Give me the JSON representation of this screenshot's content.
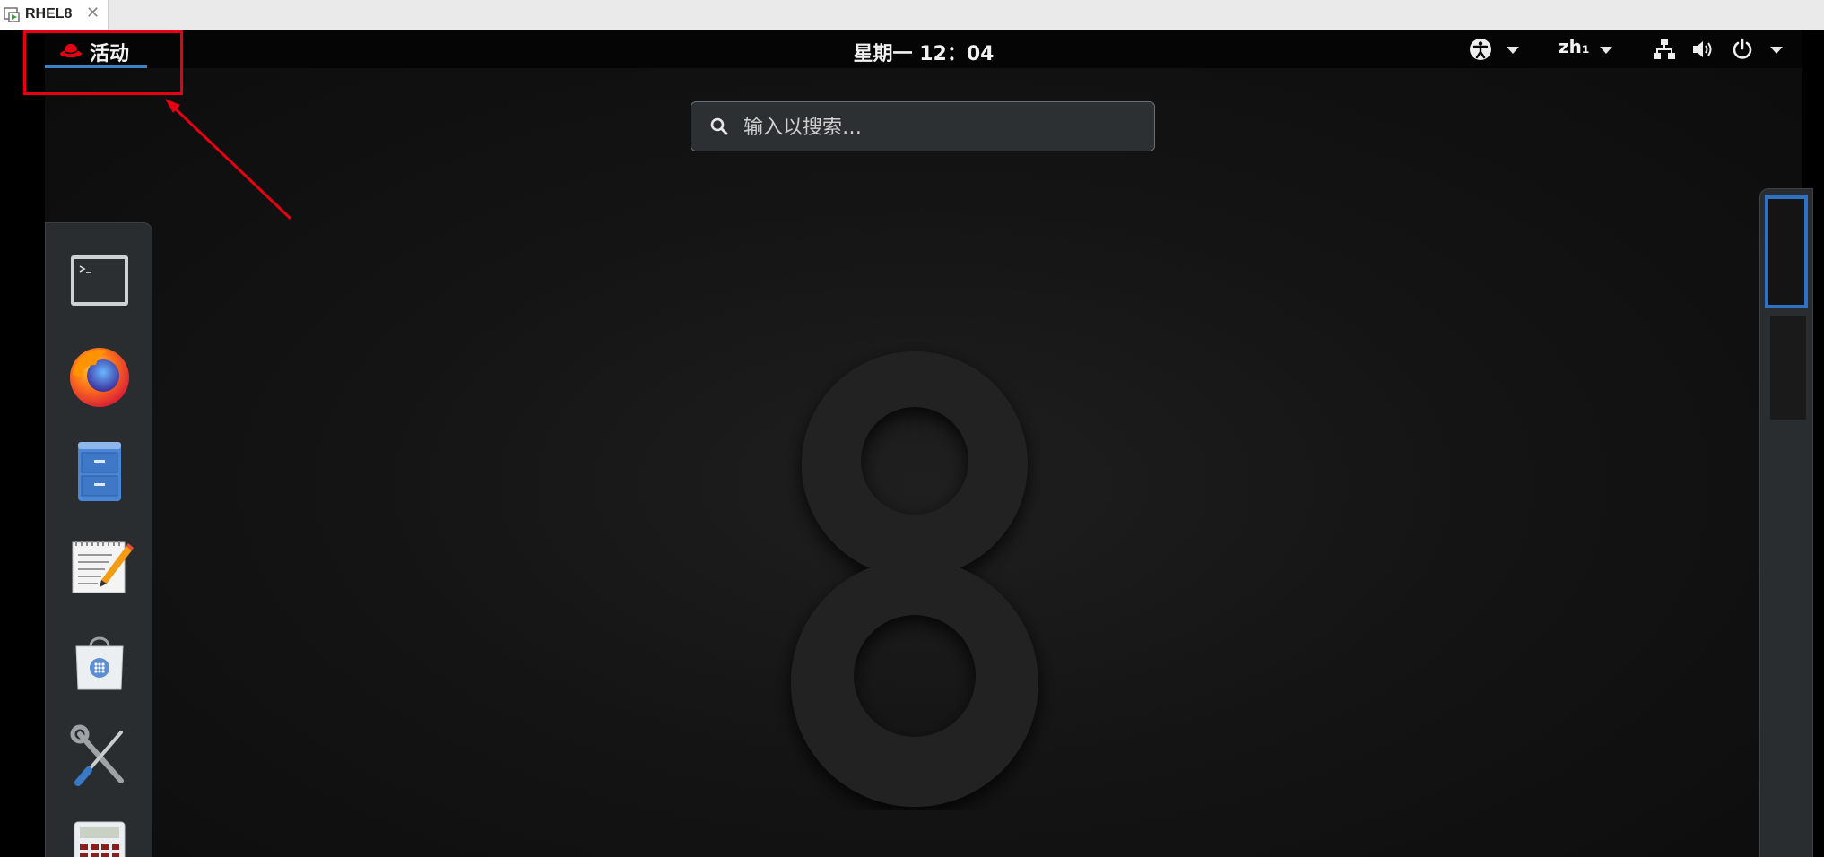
{
  "vm_tab": {
    "title": "RHEL8",
    "close": "✕"
  },
  "top_bar": {
    "activities_label": "活动",
    "clock": "星期一 12：04",
    "input_method": "zh₁"
  },
  "search": {
    "placeholder": "输入以搜索…"
  },
  "dash": {
    "items": [
      {
        "icon": "terminal-icon"
      },
      {
        "icon": "firefox-icon"
      },
      {
        "icon": "files-icon"
      },
      {
        "icon": "text-editor-icon"
      },
      {
        "icon": "software-icon"
      },
      {
        "icon": "utilities-icon"
      },
      {
        "icon": "calculator-icon"
      }
    ]
  },
  "wallpaper": {
    "logo_text": "8"
  },
  "colors": {
    "highlight": "#e60012",
    "accent": "#3b83c8",
    "topbar": "#050505",
    "dash_bg": "#2a2d2f"
  }
}
